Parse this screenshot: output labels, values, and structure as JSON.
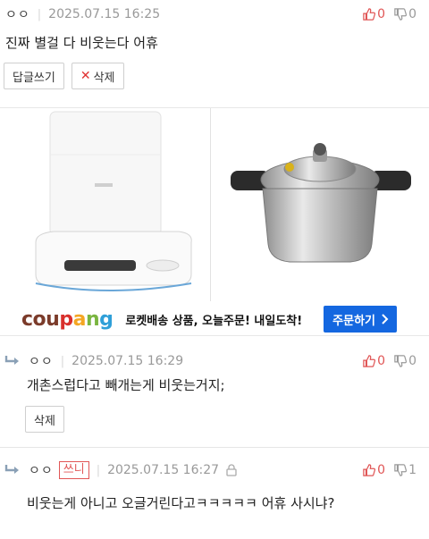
{
  "post": {
    "author": "ㅇㅇ",
    "timestamp": "2025.07.15 16:25",
    "upvotes": "0",
    "downvotes": "0",
    "content": "진짜 별걸 다 비웃는다 어휴",
    "reply_button": "답글쓰기",
    "delete_button": "삭제"
  },
  "ad": {
    "logo": [
      "cou",
      "p",
      "a",
      "n",
      "g"
    ],
    "slogan": "로켓배송 상품, 오늘주문! 내일도착!",
    "cta": "주문하기",
    "cta_icon": "chevron-right-icon",
    "products": [
      "robot-vacuum-image",
      "pressure-cooker-image"
    ]
  },
  "comments": [
    {
      "author": "ㅇㅇ",
      "timestamp": "2025.07.15 16:29",
      "upvotes": "0",
      "downvotes": "0",
      "content": "개촌스럽다고 빼개는게 비웃는거지;",
      "delete_button": "삭제"
    },
    {
      "author": "ㅇㅇ",
      "badge": "쓰니",
      "timestamp": "2025.07.15 16:27",
      "upvotes": "0",
      "downvotes": "1",
      "content": "비웃는게 아니고 오글거린다고ㅋㅋㅋㅋㅋ 어휴 사시냐?"
    }
  ],
  "colors": {
    "upvote": "#e05555",
    "downvote": "#9a9a9a",
    "cta": "#1467e0",
    "badge": "#e15656"
  }
}
